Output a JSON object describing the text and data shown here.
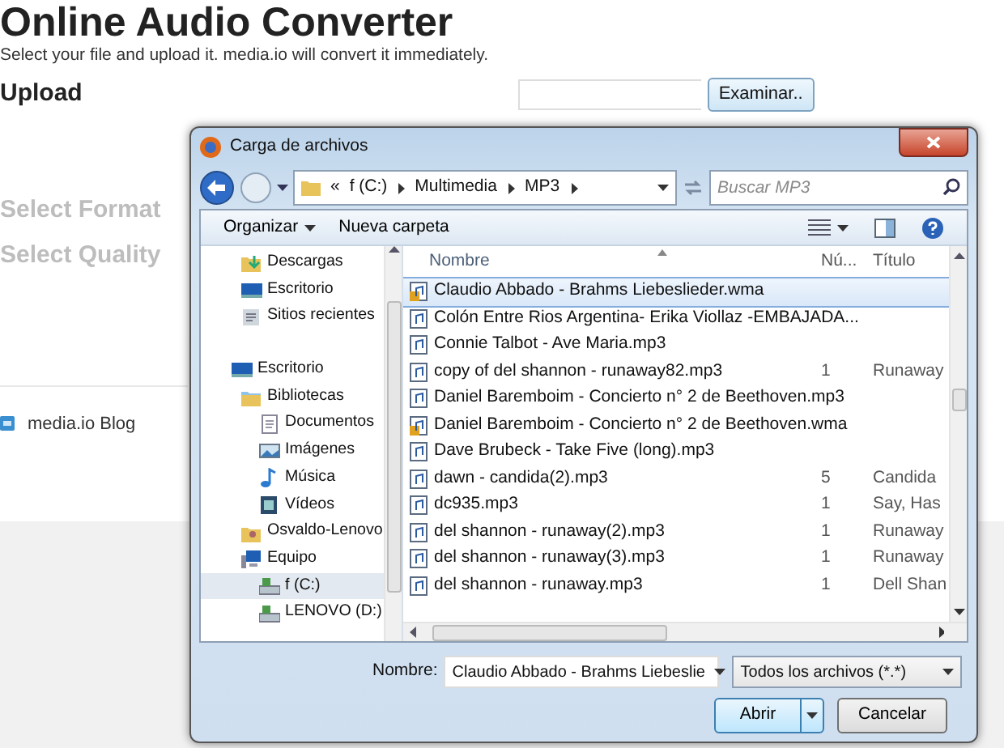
{
  "page": {
    "title": "Online Audio Converter",
    "subtitle": "Select your file and upload it. media.io will convert it immediately.",
    "upload_label": "Upload",
    "browse_button": "Examinar..",
    "format_label": "Select Format",
    "quality_label": "Select Quality",
    "blog_link": "media.io Blog"
  },
  "dialog": {
    "title": "Carga de archivos",
    "breadcrumb": [
      "«",
      "f (C:)",
      "Multimedia",
      "MP3"
    ],
    "search": {
      "placeholder": "Buscar MP3"
    },
    "toolbar": [
      "Organizar",
      "Nueva carpeta"
    ],
    "favorites": [
      {
        "label": "Descargas",
        "kind": "downloads",
        "selected": false
      },
      {
        "label": "Escritorio",
        "kind": "desktop",
        "selected": false
      },
      {
        "label": "Sitios recientes",
        "kind": "recent",
        "selected": false
      }
    ],
    "tree": [
      {
        "label": "Escritorio",
        "kind": "desktop",
        "selected": false,
        "children": [
          {
            "label": "Bibliotecas",
            "kind": "libraries",
            "selected": false,
            "children": [
              {
                "label": "Documentos",
                "kind": "documents",
                "selected": false
              },
              {
                "label": "Imágenes",
                "kind": "pictures",
                "selected": false
              },
              {
                "label": "Música",
                "kind": "music",
                "selected": false
              },
              {
                "label": "Vídeos",
                "kind": "videos",
                "selected": false
              }
            ]
          },
          {
            "label": "Osvaldo-Lenovo",
            "kind": "user",
            "selected": false
          },
          {
            "label": "Equipo",
            "kind": "computer",
            "selected": false,
            "children": [
              {
                "label": "f (C:)",
                "kind": "drive",
                "selected": true
              },
              {
                "label": "LENOVO (D:)",
                "kind": "drive",
                "selected": false
              }
            ]
          }
        ]
      }
    ],
    "columns": [
      "Nombre",
      "Nú...",
      "Título"
    ],
    "files": [
      {
        "name": "Claudio Abbado - Brahms Liebeslieder.wma",
        "kind": "wma",
        "selected": true
      },
      {
        "name": "Colón Entre Rios Argentina- Erika Viollaz -EMBAJADA...",
        "kind": "mp3",
        "selected": false
      },
      {
        "name": "Connie Talbot - Ave Maria.mp3",
        "kind": "mp3",
        "selected": false
      },
      {
        "name": "copy of del shannon - runaway82.mp3",
        "number": "1",
        "title": "Runaway",
        "kind": "mp3",
        "selected": false
      },
      {
        "name": "Daniel Baremboim - Concierto n° 2 de Beethoven.mp3",
        "kind": "mp3",
        "selected": false
      },
      {
        "name": "Daniel Baremboim - Concierto n° 2 de Beethoven.wma",
        "kind": "wma",
        "selected": false
      },
      {
        "name": "Dave Brubeck - Take Five (long).mp3",
        "kind": "mp3",
        "selected": false
      },
      {
        "name": "dawn - candida(2).mp3",
        "number": "5",
        "title": "Candida",
        "kind": "mp3",
        "selected": false
      },
      {
        "name": "dc935.mp3",
        "number": "1",
        "title": "Say, Has",
        "kind": "mp3",
        "selected": false
      },
      {
        "name": "del shannon - runaway(2).mp3",
        "number": "1",
        "title": "Runaway",
        "kind": "mp3",
        "selected": false
      },
      {
        "name": "del shannon - runaway(3).mp3",
        "number": "1",
        "title": "Runaway",
        "kind": "mp3",
        "selected": false
      },
      {
        "name": "del shannon - runaway.mp3",
        "number": "1",
        "title": "Dell Shan",
        "kind": "mp3",
        "selected": false
      }
    ],
    "name_label": "Nombre:",
    "name_value": "Claudio Abbado - Brahms Liebeslie",
    "filter": "Todos los archivos (*.*)",
    "buttons": [
      "Abrir",
      "Cancelar"
    ]
  }
}
